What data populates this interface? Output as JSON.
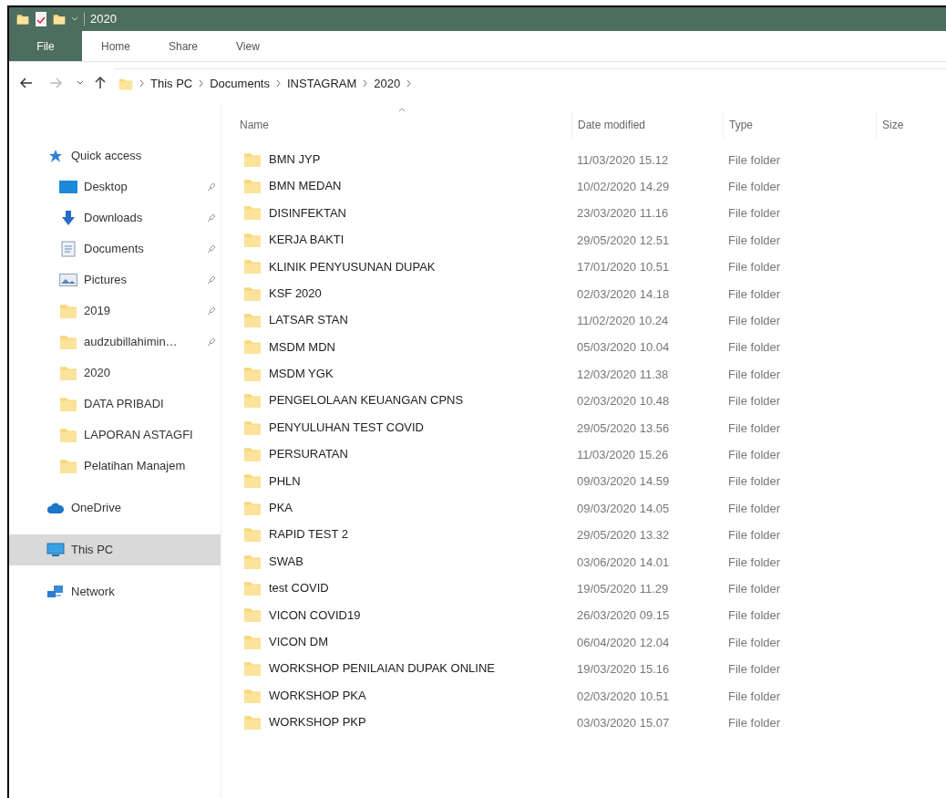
{
  "window": {
    "title": "2020"
  },
  "ribbon_tabs": [
    {
      "label": "File",
      "kind": "file"
    },
    {
      "label": "Home",
      "kind": "tab"
    },
    {
      "label": "Share",
      "kind": "tab"
    },
    {
      "label": "View",
      "kind": "tab"
    }
  ],
  "breadcrumb": [
    "This PC",
    "Documents",
    "INSTAGRAM",
    "2020"
  ],
  "nav": [
    {
      "label": "Quick access",
      "kind": "star",
      "selected": false,
      "children": [
        {
          "label": "Desktop",
          "kind": "desktop",
          "pinned": true,
          "selected": false
        },
        {
          "label": "Downloads",
          "kind": "download",
          "pinned": true,
          "selected": false
        },
        {
          "label": "Documents",
          "kind": "document",
          "pinned": true,
          "selected": false
        },
        {
          "label": "Pictures",
          "kind": "pictures",
          "pinned": true,
          "selected": false
        },
        {
          "label": "2019",
          "kind": "folder",
          "pinned": true,
          "selected": false
        },
        {
          "label": "audzubillahimin…",
          "kind": "folder",
          "pinned": true,
          "selected": false
        },
        {
          "label": "2020",
          "kind": "folder",
          "pinned": false,
          "selected": false
        },
        {
          "label": "DATA PRIBADI",
          "kind": "folder",
          "pinned": false,
          "selected": false
        },
        {
          "label": "LAPORAN ASTAGFI",
          "kind": "folder",
          "pinned": false,
          "selected": false
        },
        {
          "label": "Pelatihan Manajem",
          "kind": "folder",
          "pinned": false,
          "selected": false
        }
      ]
    },
    {
      "label": "OneDrive",
      "kind": "cloud",
      "selected": false
    },
    {
      "label": "This PC",
      "kind": "pc",
      "selected": true
    },
    {
      "label": "Network",
      "kind": "network",
      "selected": false
    }
  ],
  "table": {
    "columns": [
      "Name",
      "Date modified",
      "Type",
      "Size"
    ],
    "rows": [
      [
        "BMN JYP",
        "11/03/2020 15.12",
        "File folder"
      ],
      [
        "BMN MEDAN",
        "10/02/2020 14.29",
        "File folder"
      ],
      [
        "DISINFEKTAN",
        "23/03/2020 11.16",
        "File folder"
      ],
      [
        "KERJA BAKTI",
        "29/05/2020 12.51",
        "File folder"
      ],
      [
        "KLINIK PENYUSUNAN DUPAK",
        "17/01/2020 10.51",
        "File folder"
      ],
      [
        "KSF 2020",
        "02/03/2020 14.18",
        "File folder"
      ],
      [
        "LATSAR STAN",
        "11/02/2020 10.24",
        "File folder"
      ],
      [
        "MSDM MDN",
        "05/03/2020 10.04",
        "File folder"
      ],
      [
        "MSDM YGK",
        "12/03/2020 11.38",
        "File folder"
      ],
      [
        "PENGELOLAAN KEUANGAN CPNS",
        "02/03/2020 10.48",
        "File folder"
      ],
      [
        "PENYULUHAN TEST COVID",
        "29/05/2020 13.56",
        "File folder"
      ],
      [
        "PERSURATAN",
        "11/03/2020 15.26",
        "File folder"
      ],
      [
        "PHLN",
        "09/03/2020 14.59",
        "File folder"
      ],
      [
        "PKA",
        "09/03/2020 14.05",
        "File folder"
      ],
      [
        "RAPID TEST 2",
        "29/05/2020 13.32",
        "File folder"
      ],
      [
        "SWAB",
        "03/06/2020 14.01",
        "File folder"
      ],
      [
        "test COVID",
        "19/05/2020 11.29",
        "File folder"
      ],
      [
        "VICON COVID19",
        "26/03/2020 09.15",
        "File folder"
      ],
      [
        "VICON DM",
        "06/04/2020 12.04",
        "File folder"
      ],
      [
        "WORKSHOP PENILAIAN DUPAK ONLINE",
        "19/03/2020 15.16",
        "File folder"
      ],
      [
        "WORKSHOP PKA",
        "02/03/2020 10.51",
        "File folder"
      ],
      [
        "WORKSHOP PKP",
        "03/03/2020 15.07",
        "File folder"
      ]
    ]
  }
}
